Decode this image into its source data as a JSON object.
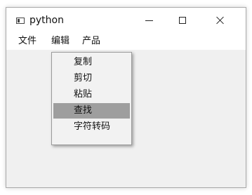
{
  "window": {
    "title": "python",
    "controls": {
      "minimize": "minimize",
      "maximize": "maximize",
      "close": "close"
    }
  },
  "menubar": {
    "items": [
      {
        "label": "文件"
      },
      {
        "label": "编辑"
      },
      {
        "label": "产品"
      }
    ]
  },
  "edit_menu": {
    "items": [
      {
        "label": "复制"
      },
      {
        "label": "剪切"
      },
      {
        "label": "粘贴"
      },
      {
        "label": "查找",
        "highlighted": true
      },
      {
        "label": "字符转码"
      }
    ]
  },
  "colors": {
    "highlight": "#9e9e9e",
    "menu_background": "#f2f2f2",
    "window_background": "#f0f0f0"
  }
}
